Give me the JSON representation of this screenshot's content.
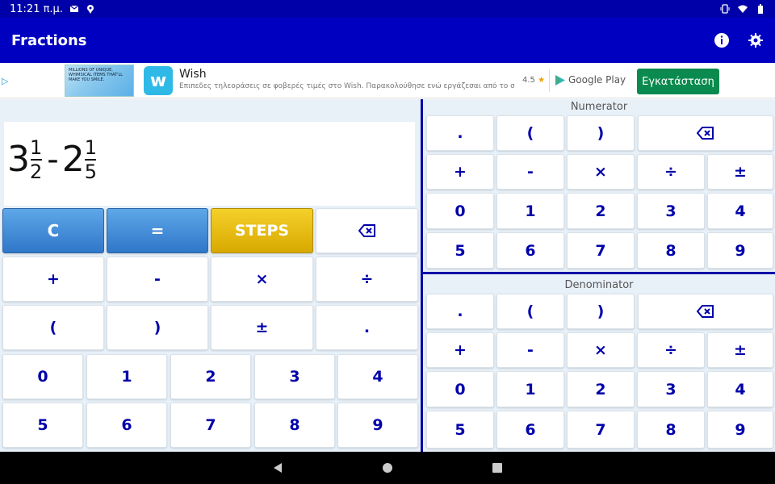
{
  "status": {
    "time": "11:21 π.μ."
  },
  "app": {
    "title": "Fractions"
  },
  "ad": {
    "name": "Wish",
    "description": "Επιπεδες τηλεοράσεις σε φοβερές τιμές στο Wish. Παρακολούθησε ενώ εργάζεσαι από το σπίτι.",
    "rating": "4.5",
    "store": "Google Play",
    "install": "Εγκατάσταση",
    "image_text": "MILLIONS OF UNIQUE, WHIMSICAL ITEMS THAT'LL MAKE YOU SMILE."
  },
  "expression": {
    "a_whole": "3",
    "a_num": "1",
    "a_den": "2",
    "op": "-",
    "b_whole": "2",
    "b_num": "1",
    "b_den": "5"
  },
  "left_keys": {
    "clear": "C",
    "equals": "=",
    "steps": "STEPS",
    "plus": "+",
    "minus": "-",
    "times": "×",
    "divide": "÷",
    "lparen": "(",
    "rparen": ")",
    "plusminus": "±",
    "dot": ".",
    "d0": "0",
    "d1": "1",
    "d2": "2",
    "d3": "3",
    "d4": "4",
    "d5": "5",
    "d6": "6",
    "d7": "7",
    "d8": "8",
    "d9": "9"
  },
  "numerator": {
    "label": "Numerator",
    "dot": ".",
    "lparen": "(",
    "rparen": ")",
    "plus": "+",
    "minus": "-",
    "times": "×",
    "divide": "÷",
    "plusminus": "±",
    "d0": "0",
    "d1": "1",
    "d2": "2",
    "d3": "3",
    "d4": "4",
    "d5": "5",
    "d6": "6",
    "d7": "7",
    "d8": "8",
    "d9": "9"
  },
  "denominator": {
    "label": "Denominator",
    "dot": ".",
    "lparen": "(",
    "rparen": ")",
    "plus": "+",
    "minus": "-",
    "times": "×",
    "divide": "÷",
    "plusminus": "±",
    "d0": "0",
    "d1": "1",
    "d2": "2",
    "d3": "3",
    "d4": "4",
    "d5": "5",
    "d6": "6",
    "d7": "7",
    "d8": "8",
    "d9": "9"
  }
}
